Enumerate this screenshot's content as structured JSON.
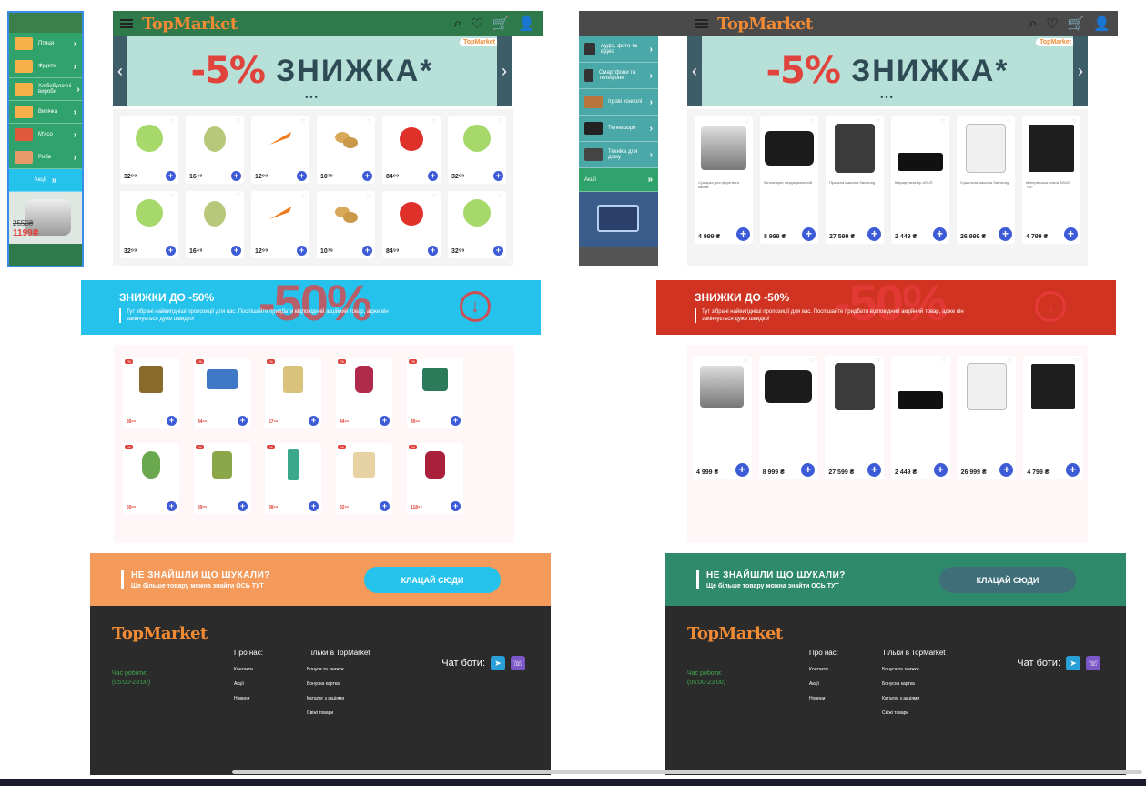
{
  "left": {
    "header": {
      "logo": "TopMarket"
    },
    "sidebar": {
      "items": [
        {
          "label": "Птиця"
        },
        {
          "label": "Фрукти"
        },
        {
          "label": "Хлібобулочні вироби"
        },
        {
          "label": "Випічка"
        },
        {
          "label": "М'ясо"
        },
        {
          "label": "Риба"
        }
      ],
      "promo_label": "Акції",
      "ad_price_old": "2550₴",
      "ad_price_new": "1199₴"
    },
    "banner": {
      "percent": "-5%",
      "word": "ЗНИЖКА*",
      "brand": "TopMarket"
    },
    "products": [
      {
        "price": "32⁹⁹"
      },
      {
        "price": "16⁴⁹"
      },
      {
        "price": "12⁹⁹"
      },
      {
        "price": "10⁷⁹"
      },
      {
        "price": "84⁹⁹"
      },
      {
        "price": "32⁹⁹"
      },
      {
        "price": "32⁹⁹"
      },
      {
        "price": "16⁴⁹"
      },
      {
        "price": "12⁹⁹"
      },
      {
        "price": "10⁷⁹"
      },
      {
        "price": "84⁹⁹"
      },
      {
        "price": "32⁹⁹"
      }
    ],
    "strip": {
      "title": "ЗНИЖКИ ДО -50%",
      "text": "Тут зібрані найвигідніші пропозиції для вас. Поспішайте придбати відповідний акційний товар, адже він закінчується дуже швидко!",
      "big": "-50%"
    },
    "sale_items": [
      {
        "price": "89⁹⁹"
      },
      {
        "price": "44⁹⁹"
      },
      {
        "price": "57⁹⁹"
      },
      {
        "price": "44⁹⁹"
      },
      {
        "price": "49⁹⁹"
      },
      {
        "price": "59⁹⁹"
      },
      {
        "price": "89⁹⁹"
      },
      {
        "price": "38⁹⁹"
      },
      {
        "price": "32⁹⁹"
      },
      {
        "price": "118⁹⁹"
      }
    ],
    "cta": {
      "title": "НЕ ЗНАЙШЛИ ЩО ШУКАЛИ?",
      "sub": "Ще більше товару можна знайти ОСЬ ТУТ",
      "button": "КЛАЦАЙ СЮДИ"
    }
  },
  "right": {
    "header": {
      "logo": "TopMarket"
    },
    "sidebar": {
      "items": [
        {
          "label": "Аудіо, фото та відео"
        },
        {
          "label": "Смартфони та телефони"
        },
        {
          "label": "Ігрові консолі"
        },
        {
          "label": "Телевізори"
        },
        {
          "label": "Техніка для дому"
        }
      ],
      "promo_label": "Акції"
    },
    "banner": {
      "percent": "-5%",
      "word": "ЗНИЖКА*",
      "brand": "TopMarket"
    },
    "products": [
      {
        "name": "Сушарка для фруктів та овочів",
        "price": "4 999 ₴"
      },
      {
        "name": "Фотоапарат бездзеркальний",
        "price": "8 999 ₴"
      },
      {
        "name": "Пральна машина Samsung",
        "price": "27 599 ₴"
      },
      {
        "name": "Маршрутизатор ASUS",
        "price": "2 449 ₴"
      },
      {
        "name": "Сушильна машина Samsung",
        "price": "26 999 ₴"
      },
      {
        "name": "Материнська плата ASUS TUF",
        "price": "4 799 ₴"
      }
    ],
    "strip": {
      "title": "ЗНИЖКИ ДО -50%",
      "text": "Тут зібрані найвигідніші пропозиції для вас. Поспішайте придбати відповідний акційний товар, адже він закінчується дуже швидко!",
      "big": "-50%"
    },
    "sale_items": [
      {
        "price": "4 999 ₴"
      },
      {
        "price": "8 999 ₴"
      },
      {
        "price": "27 599 ₴"
      },
      {
        "price": "2 449 ₴"
      },
      {
        "price": "26 999 ₴"
      },
      {
        "price": "4 799 ₴"
      }
    ],
    "cta": {
      "title": "НЕ ЗНАЙШЛИ ЩО ШУКАЛИ?",
      "sub": "Ще більше товару можна знайти ОСЬ ТУТ",
      "button": "КЛАЦАЙ СЮДИ"
    }
  },
  "footer": {
    "logo": "TopMarket",
    "hours_label": "Час роботи:",
    "hours": "(05:00-23:00)",
    "about_title": "Про нас:",
    "about_links": [
      "Контакти",
      "Акції",
      "Новини"
    ],
    "only_title": "Тільки в TopMarket",
    "only_links": [
      "Бонуси та знижки",
      "Бонусна картка",
      "Каталог з акціями",
      "Свіжі товари"
    ],
    "bots_label": "Чат боти:"
  },
  "colors": {
    "green": "#2fa36b",
    "teal_side": "#4aa8a8",
    "blue_strip": "#25c2ec",
    "red_strip": "#d03322",
    "orange_cta": "#f49a5a",
    "green_cta": "#2e8a6a",
    "cta_btn_blue": "#25c2ec",
    "cta_btn_dark": "#3e6e78"
  }
}
